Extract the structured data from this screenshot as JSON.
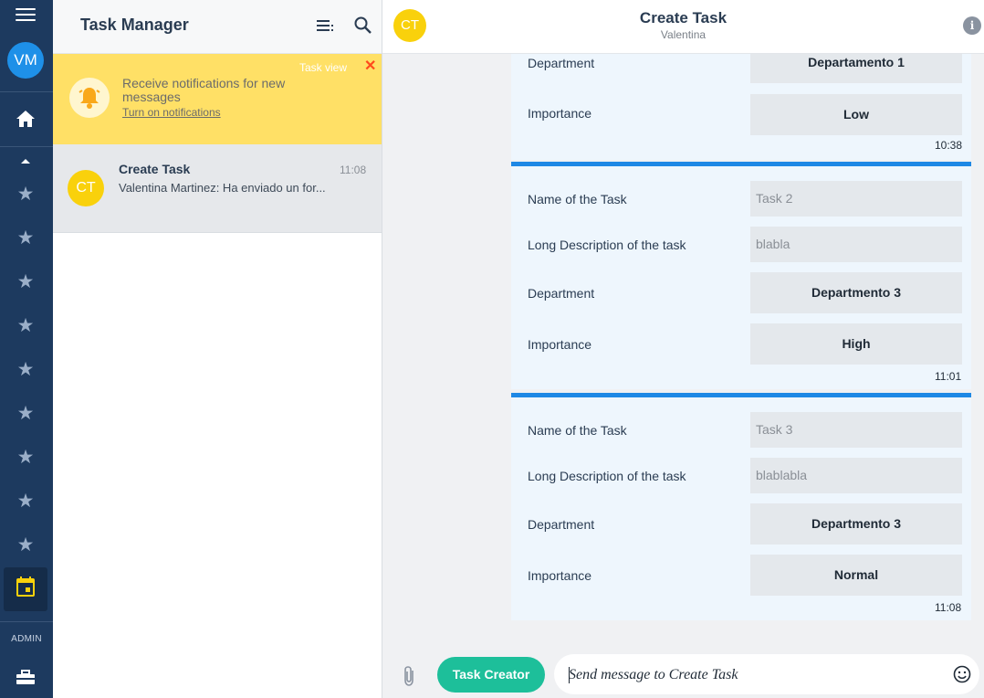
{
  "rail": {
    "avatar_initials": "VM",
    "admin_label": "ADMIN",
    "star_count": 9
  },
  "list": {
    "title": "Task Manager",
    "notification": {
      "message": "Receive notifications for new messages",
      "link": "Turn on notifications",
      "badge": "Task view",
      "close": "✕"
    },
    "chat": {
      "initials": "CT",
      "name": "Create Task",
      "time": "11:08",
      "preview": "Valentina Martinez: Ha enviado un for..."
    }
  },
  "main": {
    "header": {
      "initials": "CT",
      "title": "Create Task",
      "subtitle": "Valentina",
      "info": "i"
    },
    "card1": {
      "dept_label": "Department",
      "dept_value": "Departamento 1",
      "imp_label": "Importance",
      "imp_value": "Low",
      "time": "10:38"
    },
    "card2": {
      "name_label": "Name of the Task",
      "name_value": "Task 2",
      "desc_label": "Long Description of the task",
      "desc_value": "blabla",
      "dept_label": "Department",
      "dept_value": "Departmento 3",
      "imp_label": "Importance",
      "imp_value": "High",
      "time": "11:01"
    },
    "card3": {
      "name_label": "Name of the Task",
      "name_value": "Task 3",
      "desc_label": "Long Description of the task",
      "desc_value": "blablabla",
      "dept_label": "Department",
      "dept_value": "Departmento 3",
      "imp_label": "Importance",
      "imp_value": "Normal",
      "time": "11:08"
    },
    "composer": {
      "button": "Task Creator",
      "placeholder": "Send message to Create Task"
    }
  },
  "colors": {
    "rail_bg": "#1d3a5f",
    "notification_bg": "#ffe066",
    "accent_blue": "#1e88e5",
    "task_button": "#1dbf9a",
    "avatar_yellow": "#f9d10c"
  }
}
